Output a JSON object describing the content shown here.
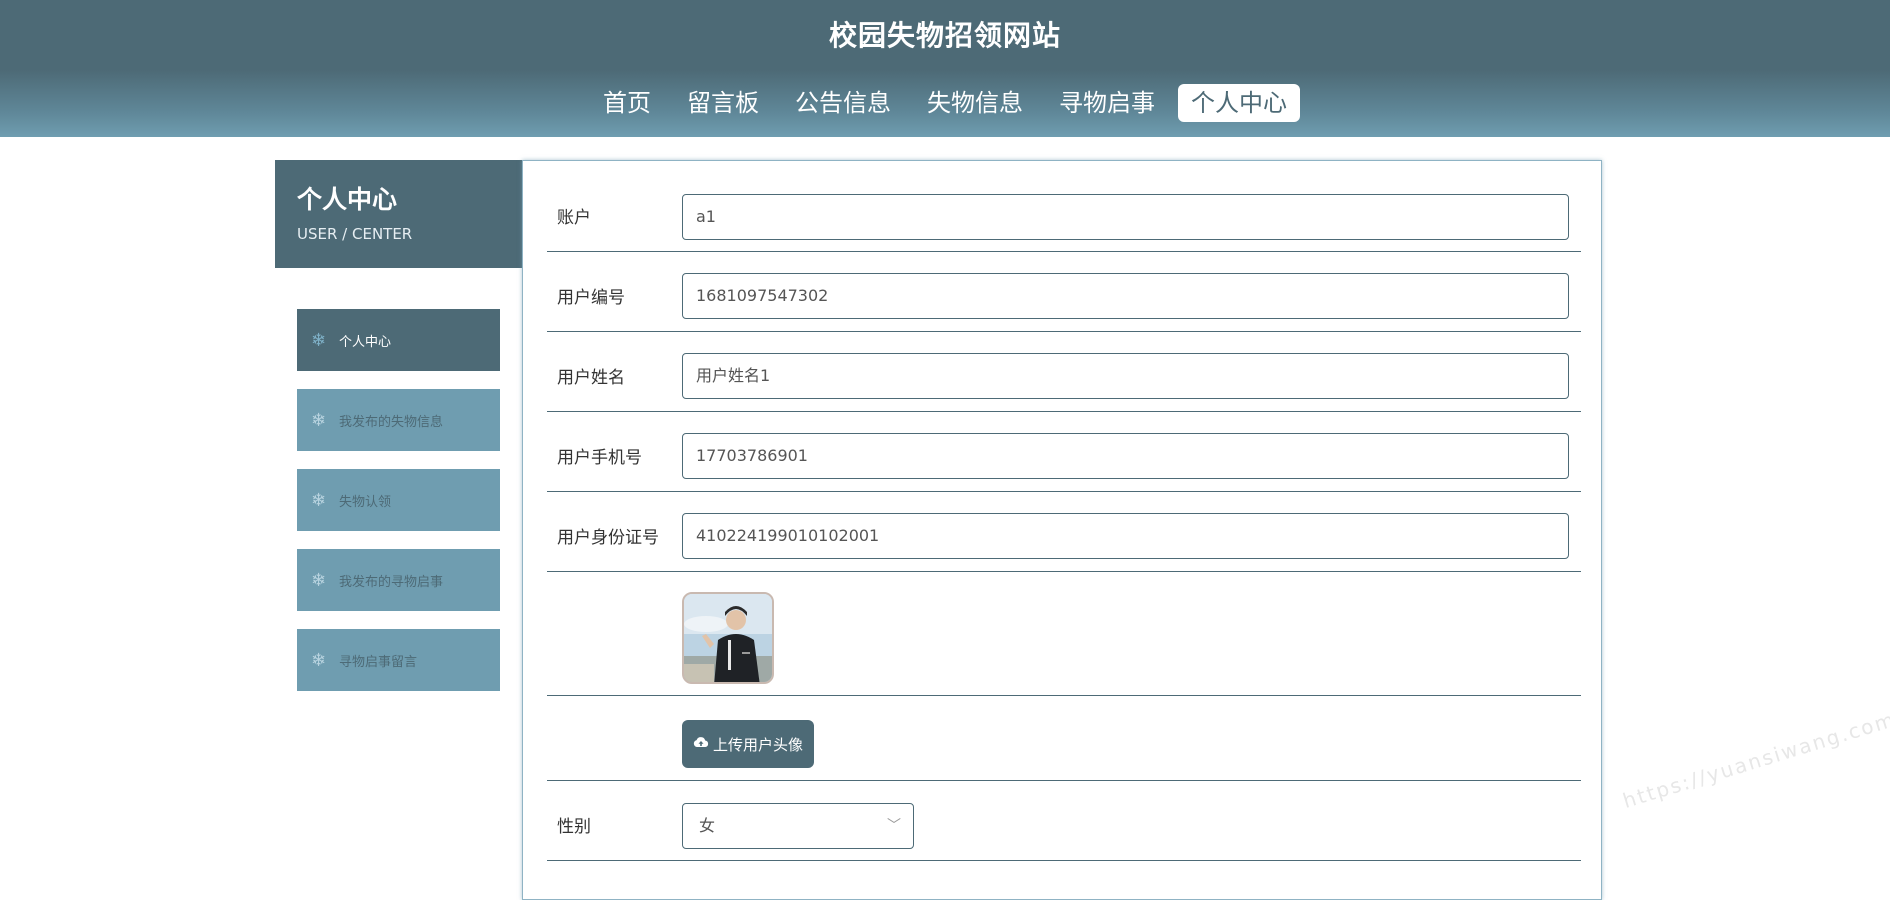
{
  "site": {
    "title": "校园失物招领网站"
  },
  "nav": [
    {
      "label": "首页",
      "active": false
    },
    {
      "label": "留言板",
      "active": false
    },
    {
      "label": "公告信息",
      "active": false
    },
    {
      "label": "失物信息",
      "active": false
    },
    {
      "label": "寻物启事",
      "active": false
    },
    {
      "label": "个人中心",
      "active": true
    }
  ],
  "sidebar": {
    "title": "个人中心",
    "subtitle": "USER / CENTER",
    "items": [
      {
        "label": "个人中心",
        "icon": "snowflake-icon",
        "active": true
      },
      {
        "label": "我发布的失物信息",
        "icon": "snowflake-icon",
        "active": false
      },
      {
        "label": "失物认领",
        "icon": "snowflake-icon",
        "active": false
      },
      {
        "label": "我发布的寻物启事",
        "icon": "snowflake-icon",
        "active": false
      },
      {
        "label": "寻物启事留言",
        "icon": "snowflake-icon",
        "active": false
      }
    ]
  },
  "form": {
    "account": {
      "label": "账户",
      "value": "a1"
    },
    "user_no": {
      "label": "用户编号",
      "value": "1681097547302"
    },
    "user_name": {
      "label": "用户姓名",
      "value": "用户姓名1"
    },
    "phone": {
      "label": "用户手机号",
      "value": "17703786901"
    },
    "id_card": {
      "label": "用户身份证号",
      "value": "410224199010102001"
    },
    "avatar_icon": "user-photo",
    "upload": {
      "label": "上传用户头像",
      "icon": "cloud-upload-icon"
    },
    "gender": {
      "label": "性别",
      "value": "女"
    }
  },
  "watermark": "https://yuansiwang.com",
  "colors": {
    "primary": "#4d6a76",
    "secondary": "#6f9db0"
  }
}
